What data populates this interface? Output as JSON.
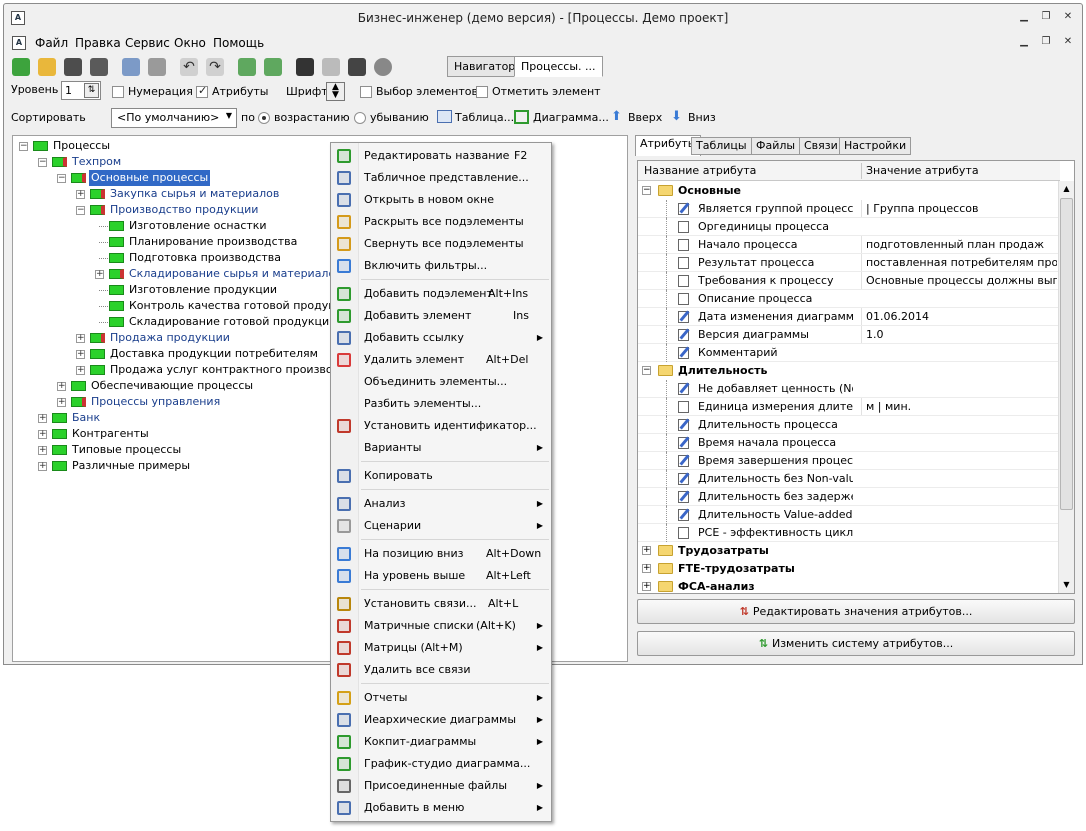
{
  "window": {
    "title": "Бизнес-инженер (демо версия) - [Процессы. Демо проект]",
    "app_icon": "app-logo-icon"
  },
  "menu": [
    "Файл",
    "Правка",
    "Сервис",
    "Окно",
    "Помощь"
  ],
  "toolbar": {
    "level_label": "Уровень",
    "level_value": "1",
    "numbering_label": "Нумерация",
    "numbering_checked": false,
    "attributes_label": "Атрибуты",
    "attributes_checked": true,
    "font_label": "Шрифт",
    "select_elements_label": "Выбор элементов",
    "mark_element_label": "Отметить элемент",
    "sort_label": "Сортировать",
    "sort_value": "<По умолчанию>",
    "by_label": "по",
    "asc_label": "возрастанию",
    "desc_label": "убыванию",
    "table_label": "Таблица...",
    "diagram_label": "Диаграмма...",
    "up_label": "Вверх",
    "down_label": "Вниз",
    "tabs": [
      "Навигатор",
      "Процессы. ..."
    ]
  },
  "tree": {
    "items": [
      {
        "label": "Процессы",
        "level": 0,
        "expand": "-",
        "style": "normal",
        "red": false
      },
      {
        "label": "Техпром",
        "level": 1,
        "expand": "-",
        "style": "blue",
        "red": true
      },
      {
        "label": "Основные процессы",
        "level": 2,
        "expand": "-",
        "style": "selected",
        "red": true
      },
      {
        "label": "Закупка сырья и материалов",
        "level": 3,
        "expand": "+",
        "style": "blue",
        "red": true
      },
      {
        "label": "Производство продукции",
        "level": 3,
        "expand": "-",
        "style": "blue",
        "red": true
      },
      {
        "label": "Изготовление оснастки",
        "level": 4,
        "expand": "",
        "style": "normal",
        "red": false
      },
      {
        "label": "Планирование производства",
        "level": 4,
        "expand": "",
        "style": "normal",
        "red": false
      },
      {
        "label": "Подготовка производства",
        "level": 4,
        "expand": "",
        "style": "normal",
        "red": false
      },
      {
        "label": "Складирование сырья и материалов",
        "level": 4,
        "expand": "+",
        "style": "blue",
        "red": true
      },
      {
        "label": "Изготовление продукции",
        "level": 4,
        "expand": "",
        "style": "normal",
        "red": false
      },
      {
        "label": "Контроль качества готовой продукции",
        "level": 4,
        "expand": "",
        "style": "normal",
        "red": false
      },
      {
        "label": "Складирование готовой продукции",
        "level": 4,
        "expand": "",
        "style": "normal",
        "red": false
      },
      {
        "label": "Продажа продукции",
        "level": 3,
        "expand": "+",
        "style": "blue",
        "red": true
      },
      {
        "label": "Доставка продукции потребителям",
        "level": 3,
        "expand": "+",
        "style": "normal",
        "red": false
      },
      {
        "label": "Продажа услуг контрактного производства",
        "level": 3,
        "expand": "+",
        "style": "normal",
        "red": false
      },
      {
        "label": "Обеспечивающие процессы",
        "level": 2,
        "expand": "+",
        "style": "normal",
        "red": false
      },
      {
        "label": "Процессы управления",
        "level": 2,
        "expand": "+",
        "style": "blue",
        "red": true
      },
      {
        "label": "Банк",
        "level": 1,
        "expand": "+",
        "style": "blue",
        "red": false
      },
      {
        "label": "Контрагенты",
        "level": 1,
        "expand": "+",
        "style": "normal",
        "red": false
      },
      {
        "label": "Типовые процессы",
        "level": 1,
        "expand": "+",
        "style": "normal",
        "red": false
      },
      {
        "label": "Различные примеры",
        "level": 1,
        "expand": "+",
        "style": "normal",
        "red": false
      }
    ]
  },
  "right_panel": {
    "tabs": [
      "Атрибуты",
      "Таблицы",
      "Файлы",
      "Связи",
      "Настройки"
    ],
    "col_name": "Название атрибута",
    "col_value": "Значение атрибута",
    "rows": [
      {
        "kind": "group",
        "label": "Основные",
        "expand": "-"
      },
      {
        "kind": "row",
        "name": "Является группой процессов",
        "value": "| Группа процессов",
        "icon": "pen"
      },
      {
        "kind": "row",
        "name": "Оргединицы процесса",
        "value": "",
        "icon": "doc"
      },
      {
        "kind": "row",
        "name": "Начало процесса",
        "value": "подготовленный план продаж",
        "icon": "doc"
      },
      {
        "kind": "row",
        "name": "Результат процесса",
        "value": "поставленная потребителям проду...",
        "icon": "doc"
      },
      {
        "kind": "row",
        "name": "Требования к процессу",
        "value": "Основные процессы должны выпо...",
        "icon": "doc"
      },
      {
        "kind": "row",
        "name": "Описание процесса",
        "value": "",
        "icon": "doc"
      },
      {
        "kind": "row",
        "name": "Дата изменения диаграммы",
        "value": "01.06.2014",
        "icon": "pen"
      },
      {
        "kind": "row",
        "name": "Версия диаграммы",
        "value": "1.0",
        "icon": "pen"
      },
      {
        "kind": "row",
        "name": "Комментарий",
        "value": "",
        "icon": "pen"
      },
      {
        "kind": "group",
        "label": "Длительность",
        "expand": "-"
      },
      {
        "kind": "row",
        "name": "Не добавляет ценность (No...",
        "value": "",
        "icon": "pen"
      },
      {
        "kind": "row",
        "name": "Единица измерения длител...",
        "value": "м | мин.",
        "icon": "doc"
      },
      {
        "kind": "row",
        "name": "Длительность процесса",
        "value": "",
        "icon": "pen"
      },
      {
        "kind": "row",
        "name": "Время начала процесса",
        "value": "",
        "icon": "pen"
      },
      {
        "kind": "row",
        "name": "Время завершения процесса",
        "value": "",
        "icon": "pen"
      },
      {
        "kind": "row",
        "name": "Длительность без Non-valu...",
        "value": "",
        "icon": "pen"
      },
      {
        "kind": "row",
        "name": "Длительность без задержек",
        "value": "",
        "icon": "pen"
      },
      {
        "kind": "row",
        "name": "Длительность Value-added",
        "value": "",
        "icon": "pen"
      },
      {
        "kind": "row",
        "name": "PCE - эффективность цикла...",
        "value": "",
        "icon": "doc"
      },
      {
        "kind": "group",
        "label": "Трудозатраты",
        "expand": "+"
      },
      {
        "kind": "group",
        "label": "FTE-трудозатраты",
        "expand": "+"
      },
      {
        "kind": "group",
        "label": "ФСА-анализ",
        "expand": "+"
      }
    ],
    "edit_values_button": "Редактировать значения атрибутов...",
    "change_system_button": "Изменить систему атрибутов..."
  },
  "context_menu": {
    "items": [
      {
        "label": "Редактировать название",
        "shortcut": "F2",
        "sub": false,
        "icon": "rename-icon",
        "color": "#2e9a2e"
      },
      {
        "label": "Табличное представление...",
        "shortcut": "",
        "sub": false,
        "icon": "table-icon",
        "color": "#4a6fb0"
      },
      {
        "label": "Открыть в новом окне",
        "shortcut": "",
        "sub": false,
        "icon": "new-window-icon",
        "color": "#4a6fb0"
      },
      {
        "label": "Раскрыть все подэлементы",
        "shortcut": "",
        "sub": false,
        "icon": "expand-all-icon",
        "color": "#d49a1a"
      },
      {
        "label": "Свернуть все подэлементы",
        "shortcut": "",
        "sub": false,
        "icon": "collapse-all-icon",
        "color": "#d49a1a"
      },
      {
        "label": "Включить фильтры...",
        "shortcut": "",
        "sub": false,
        "icon": "filter-icon",
        "color": "#3a7bd5"
      },
      {
        "sep": true
      },
      {
        "label": "Добавить подэлемент",
        "shortcut": "Alt+Ins",
        "sub": false,
        "icon": "add-child-icon",
        "color": "#2e9a2e"
      },
      {
        "label": "Добавить элемент",
        "shortcut": "Ins",
        "sub": false,
        "icon": "add-icon",
        "color": "#2e9a2e"
      },
      {
        "label": "Добавить ссылку",
        "shortcut": "",
        "sub": true,
        "icon": "add-link-icon",
        "color": "#4a6fb0"
      },
      {
        "label": "Удалить элемент",
        "shortcut": "Alt+Del",
        "sub": false,
        "icon": "delete-icon",
        "color": "#d93a3a"
      },
      {
        "label": "Объединить элементы...",
        "shortcut": "",
        "sub": false,
        "icon": "",
        "color": ""
      },
      {
        "label": "Разбить элементы...",
        "shortcut": "",
        "sub": false,
        "icon": "",
        "color": ""
      },
      {
        "label": "Установить идентификатор...",
        "shortcut": "",
        "sub": false,
        "icon": "identifier-icon",
        "color": "#c0392b"
      },
      {
        "label": "Варианты",
        "shortcut": "",
        "sub": true,
        "icon": "",
        "color": ""
      },
      {
        "sep": true
      },
      {
        "label": "Копировать",
        "shortcut": "",
        "sub": false,
        "icon": "copy-icon",
        "color": "#4a6fb0"
      },
      {
        "sep": true
      },
      {
        "label": "Анализ",
        "shortcut": "",
        "sub": true,
        "icon": "analysis-icon",
        "color": "#4a6fb0"
      },
      {
        "label": "Сценарии",
        "shortcut": "",
        "sub": true,
        "icon": "scenarios-icon",
        "color": "#999999"
      },
      {
        "sep": true
      },
      {
        "label": "На позицию вниз",
        "shortcut": "Alt+Down",
        "sub": false,
        "icon": "move-down-icon",
        "color": "#3a7bd5"
      },
      {
        "label": "На уровень выше",
        "shortcut": "Alt+Left",
        "sub": false,
        "icon": "level-up-icon",
        "color": "#3a7bd5"
      },
      {
        "sep": true
      },
      {
        "label": "Установить связи...",
        "shortcut": "Alt+L",
        "sub": false,
        "icon": "links-icon",
        "color": "#b8860b"
      },
      {
        "label": "Матричные списки",
        "shortcut": "(Alt+K)",
        "sub": true,
        "icon": "matrix-list-icon",
        "color": "#c0392b"
      },
      {
        "label": "Матрицы (Alt+M)",
        "shortcut": "",
        "sub": true,
        "icon": "matrix-icon",
        "color": "#c0392b"
      },
      {
        "label": "Удалить все связи",
        "shortcut": "",
        "sub": false,
        "icon": "delete-links-icon",
        "color": "#c0392b"
      },
      {
        "sep": true
      },
      {
        "label": "Отчеты",
        "shortcut": "",
        "sub": true,
        "icon": "reports-icon",
        "color": "#d4a017"
      },
      {
        "label": "Иеархические диаграммы",
        "shortcut": "",
        "sub": true,
        "icon": "hierarchy-icon",
        "color": "#4a6fb0"
      },
      {
        "label": "Кокпит-диаграммы",
        "shortcut": "",
        "sub": true,
        "icon": "cockpit-icon",
        "color": "#2e9a2e"
      },
      {
        "label": "График-студио диаграмма...",
        "shortcut": "",
        "sub": false,
        "icon": "graph-studio-icon",
        "color": "#2e9a2e"
      },
      {
        "label": "Присоединенные файлы",
        "shortcut": "",
        "sub": true,
        "icon": "attachment-icon",
        "color": "#666666"
      },
      {
        "label": "Добавить в меню",
        "shortcut": "",
        "sub": true,
        "icon": "add-to-menu-icon",
        "color": "#4a6fb0"
      }
    ]
  }
}
